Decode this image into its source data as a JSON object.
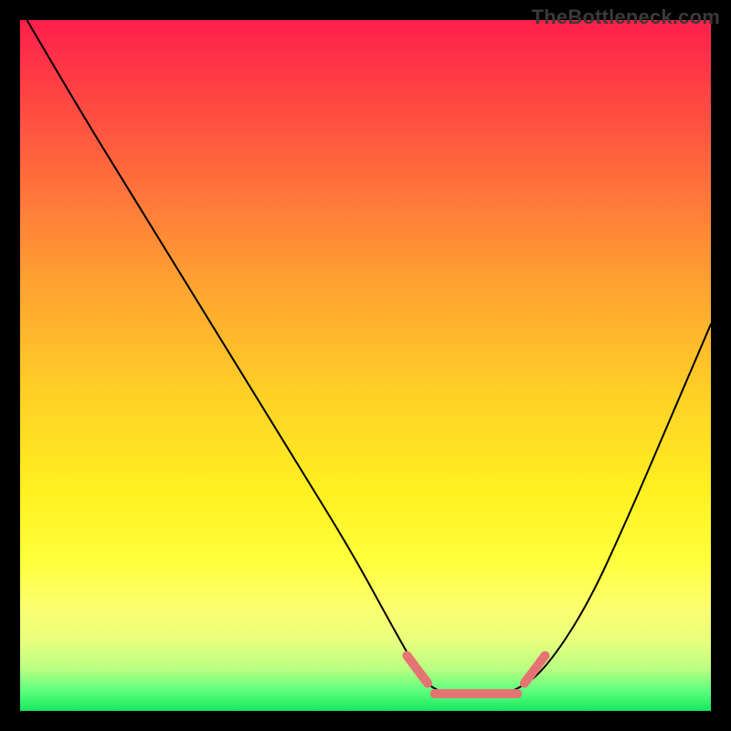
{
  "watermark": "TheBottleneck.com",
  "chart_data": {
    "type": "line",
    "title": "",
    "xlabel": "",
    "ylabel": "",
    "xlim": [
      0,
      100
    ],
    "ylim": [
      0,
      100
    ],
    "grid": false,
    "legend": false,
    "background_gradient_stops": [
      {
        "pct": 0,
        "color": "#ff1f4b"
      },
      {
        "pct": 8,
        "color": "#ff3a45"
      },
      {
        "pct": 22,
        "color": "#ff6a3c"
      },
      {
        "pct": 38,
        "color": "#ffa231"
      },
      {
        "pct": 55,
        "color": "#ffd226"
      },
      {
        "pct": 68,
        "color": "#fff020"
      },
      {
        "pct": 78,
        "color": "#ffff3a"
      },
      {
        "pct": 85,
        "color": "#fcff6e"
      },
      {
        "pct": 90,
        "color": "#e7ff7e"
      },
      {
        "pct": 94,
        "color": "#b8ff82"
      },
      {
        "pct": 97,
        "color": "#5fff7e"
      },
      {
        "pct": 100,
        "color": "#17e85f"
      }
    ],
    "series": [
      {
        "name": "bottleneck-curve",
        "color": "#000000",
        "stroke_width": 2,
        "x": [
          1,
          8,
          16,
          24,
          32,
          40,
          48,
          54,
          58,
          60,
          64,
          68,
          72,
          76,
          82,
          88,
          94,
          100
        ],
        "y": [
          100,
          88,
          75,
          62,
          49,
          36,
          23,
          12,
          5,
          3,
          2,
          2,
          3,
          6,
          15,
          28,
          42,
          56
        ]
      },
      {
        "name": "flat-minimum-highlight",
        "color": "#e57373",
        "stroke_width": 10,
        "segments": [
          {
            "x": [
              56,
              59
            ],
            "y": [
              8,
              4
            ]
          },
          {
            "x": [
              60,
              72
            ],
            "y": [
              2.5,
              2.5
            ]
          },
          {
            "x": [
              73,
              76
            ],
            "y": [
              4,
              8
            ]
          }
        ]
      }
    ],
    "annotations": []
  }
}
